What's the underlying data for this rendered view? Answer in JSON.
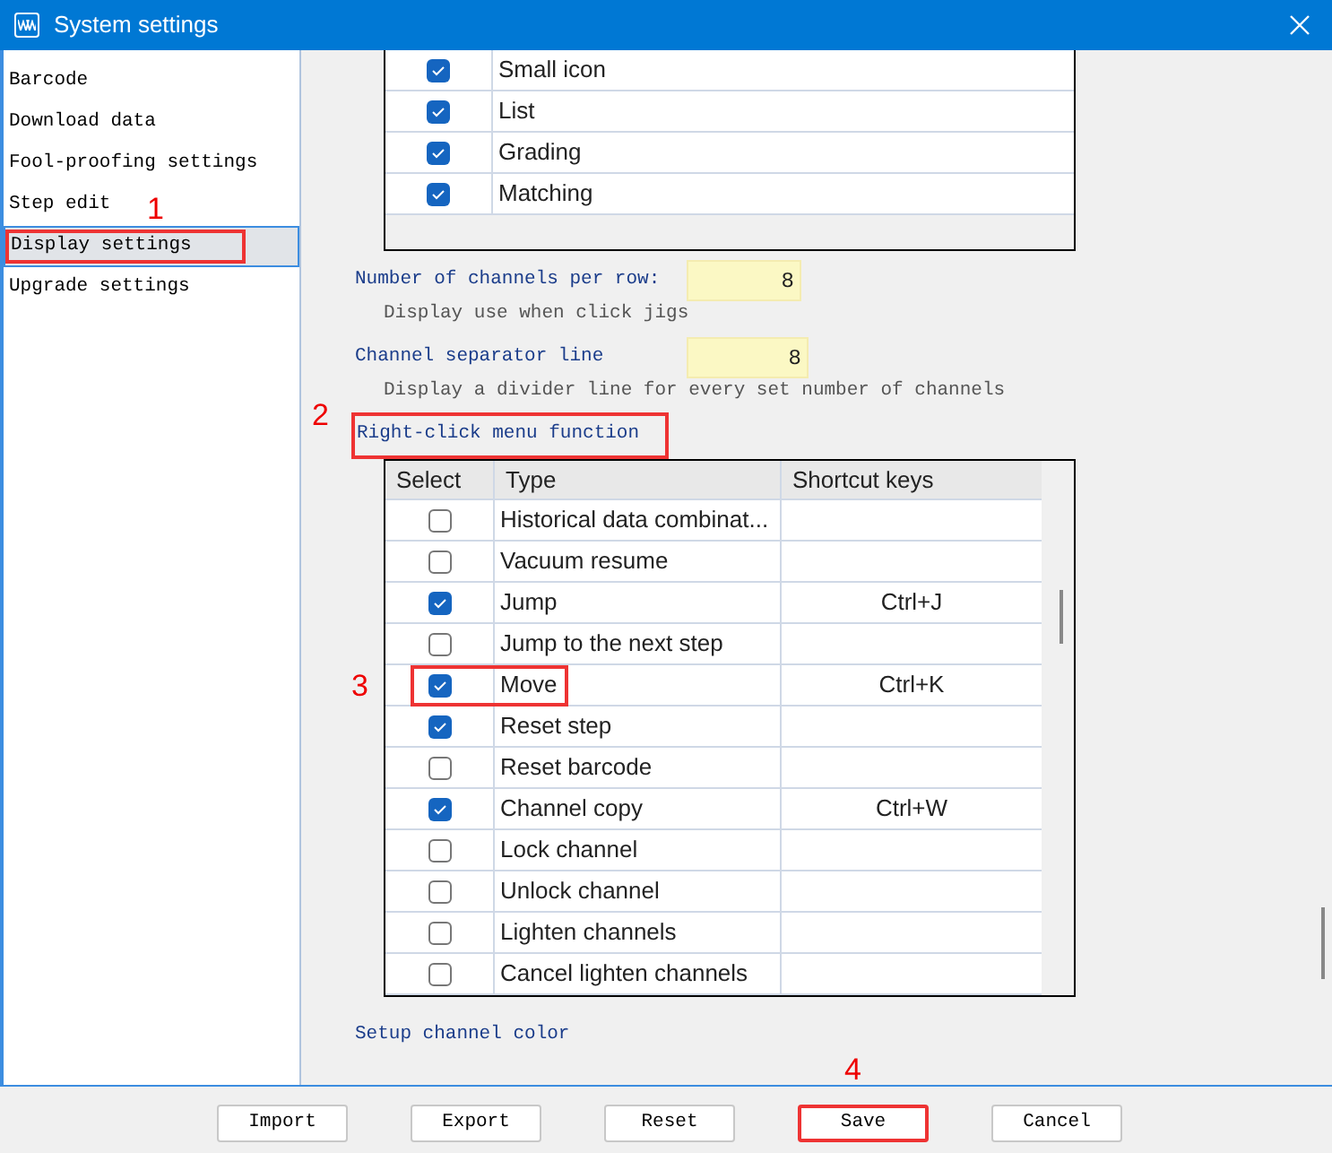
{
  "window": {
    "title": "System settings"
  },
  "sidebar": {
    "items": [
      {
        "label": "Barcode",
        "selected": false
      },
      {
        "label": "Download data",
        "selected": false
      },
      {
        "label": "Fool-proofing settings",
        "selected": false
      },
      {
        "label": "Step edit",
        "selected": false
      },
      {
        "label": "Display settings",
        "selected": true,
        "annotation": "1"
      },
      {
        "label": "Upgrade settings",
        "selected": false
      }
    ]
  },
  "view_table": {
    "rows": [
      {
        "checked": true,
        "type": "Small icon"
      },
      {
        "checked": true,
        "type": "List"
      },
      {
        "checked": true,
        "type": "Grading"
      },
      {
        "checked": true,
        "type": "Matching"
      }
    ]
  },
  "fields": [
    {
      "label": "Number of channels per row:",
      "value": "8",
      "hint": "Display use when click jigs"
    },
    {
      "label": "Channel separator line",
      "value": "8",
      "hint": "Display a divider line for every set number of channels"
    }
  ],
  "menu_section": {
    "title": "Right-click menu function",
    "annotation": "2"
  },
  "menu_table": {
    "columns": [
      "Select",
      "Type",
      "Shortcut keys"
    ],
    "rows": [
      {
        "checked": false,
        "type": "Historical data combinat...",
        "shortcut": ""
      },
      {
        "checked": false,
        "type": "Vacuum resume",
        "shortcut": ""
      },
      {
        "checked": true,
        "type": "Jump",
        "shortcut": "Ctrl+J"
      },
      {
        "checked": false,
        "type": "Jump to the next step",
        "shortcut": ""
      },
      {
        "checked": true,
        "type": "Move",
        "shortcut": "Ctrl+K",
        "annotation": "3"
      },
      {
        "checked": true,
        "type": "Reset step",
        "shortcut": ""
      },
      {
        "checked": false,
        "type": "Reset barcode",
        "shortcut": ""
      },
      {
        "checked": true,
        "type": "Channel copy",
        "shortcut": "Ctrl+W"
      },
      {
        "checked": false,
        "type": "Lock channel",
        "shortcut": ""
      },
      {
        "checked": false,
        "type": "Unlock channel",
        "shortcut": ""
      },
      {
        "checked": false,
        "type": "Lighten channels",
        "shortcut": ""
      },
      {
        "checked": false,
        "type": "Cancel lighten channels",
        "shortcut": ""
      }
    ]
  },
  "color_section": {
    "title": "Setup channel color"
  },
  "buttons": [
    {
      "label": "Import"
    },
    {
      "label": "Export"
    },
    {
      "label": "Reset"
    },
    {
      "label": "Save",
      "annotation": "4"
    },
    {
      "label": "Cancel"
    }
  ]
}
